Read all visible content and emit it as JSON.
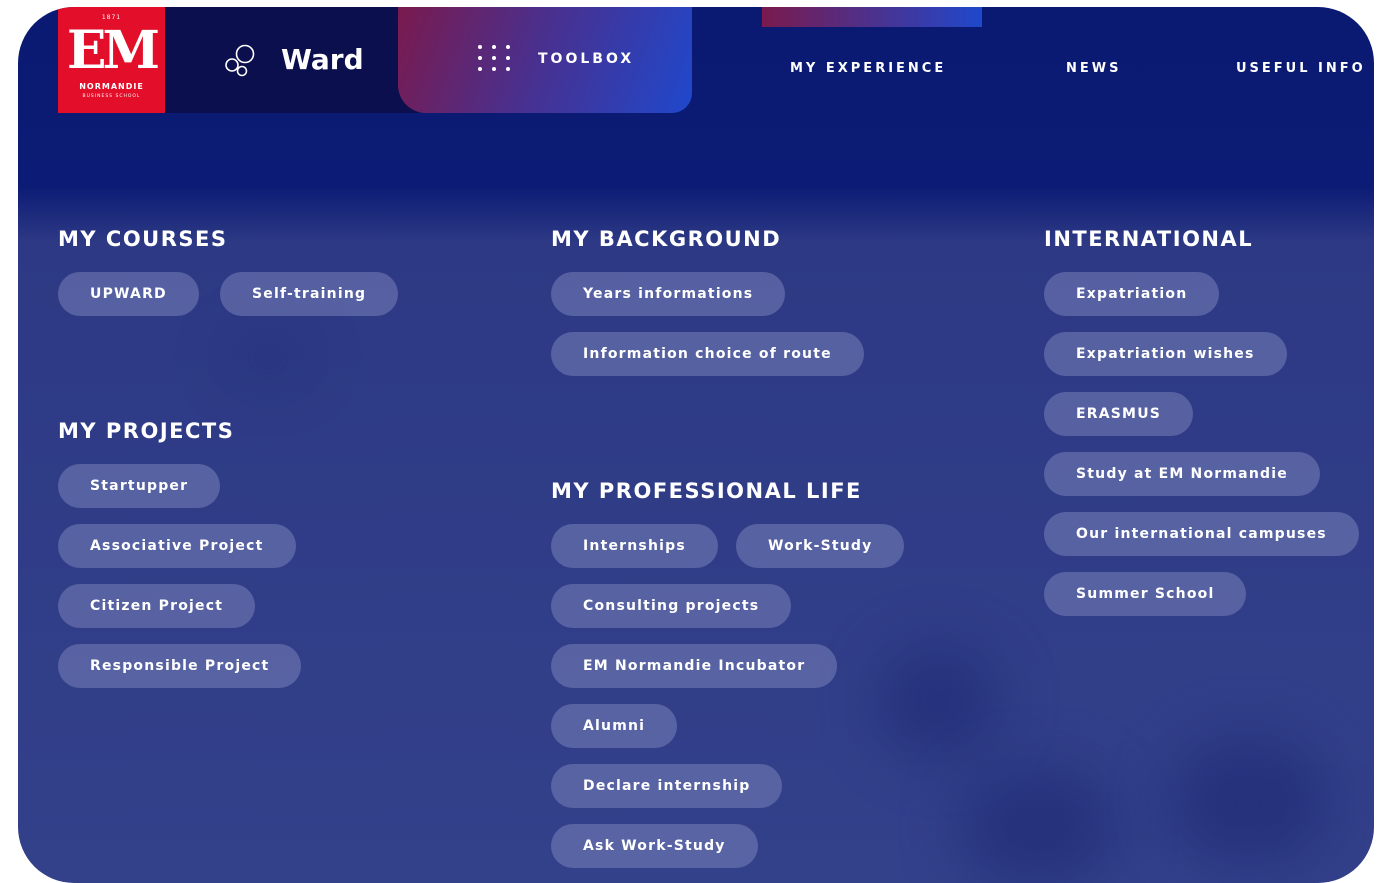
{
  "logo": {
    "year": "1871",
    "mark": "EM",
    "line1": "NORMANDIE",
    "line2": "BUSINESS SCHOOL"
  },
  "app": {
    "name": "Ward",
    "icon": "bubbles-icon"
  },
  "toolbox": {
    "label": "TOOLBOX",
    "icon": "grid-dots-icon"
  },
  "nav": {
    "items": [
      "MY EXPERIENCE",
      "NEWS",
      "USEFUL INFO"
    ]
  },
  "sections": {
    "courses": {
      "title": "MY COURSES",
      "items": [
        "UPWARD",
        "Self-training"
      ]
    },
    "projects": {
      "title": "MY PROJECTS",
      "items": [
        "Startupper",
        "Associative Project",
        "Citizen Project",
        "Responsible Project"
      ]
    },
    "background": {
      "title": "MY BACKGROUND",
      "items": [
        "Years informations",
        "Information choice of route"
      ]
    },
    "professional": {
      "title": "MY PROFESSIONAL LIFE",
      "items": [
        "Internships",
        "Work-Study",
        "Consulting projects",
        "EM Normandie Incubator",
        "Alumni",
        "Declare internship",
        "Ask Work-Study"
      ]
    },
    "international": {
      "title": "INTERNATIONAL",
      "items": [
        "Expatriation",
        "Expatriation wishes",
        "ERASMUS",
        "Study at EM Normandie",
        "Our international campuses",
        "Summer School"
      ]
    }
  },
  "colors": {
    "background": "#0a1a72",
    "logo_red": "#e30f2a",
    "ward_tile": "#0b0f4d",
    "accent_blue": "#1f48cc",
    "accent_magenta": "#7a1a4e"
  }
}
